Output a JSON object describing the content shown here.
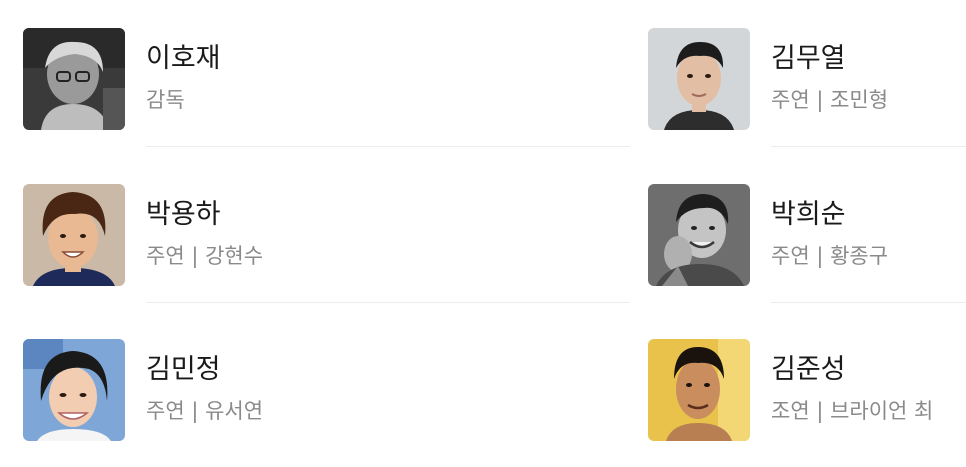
{
  "cast": [
    {
      "name": "이호재",
      "role": "감독",
      "avatar": "director-photo"
    },
    {
      "name": "김무열",
      "role": "주연 | 조민형",
      "avatar": "actor-photo"
    },
    {
      "name": "박용하",
      "role": "주연 | 강현수",
      "avatar": "actor-photo"
    },
    {
      "name": "박희순",
      "role": "주연 | 황종구",
      "avatar": "actor-photo"
    },
    {
      "name": "김민정",
      "role": "주연 | 유서연",
      "avatar": "actress-photo"
    },
    {
      "name": "김준성",
      "role": "조연 | 브라이언 최",
      "avatar": "actor-photo"
    }
  ],
  "colors": {
    "name_text": "#1a1a1a",
    "role_text": "#8a8a8a",
    "divider": "#ececec"
  }
}
